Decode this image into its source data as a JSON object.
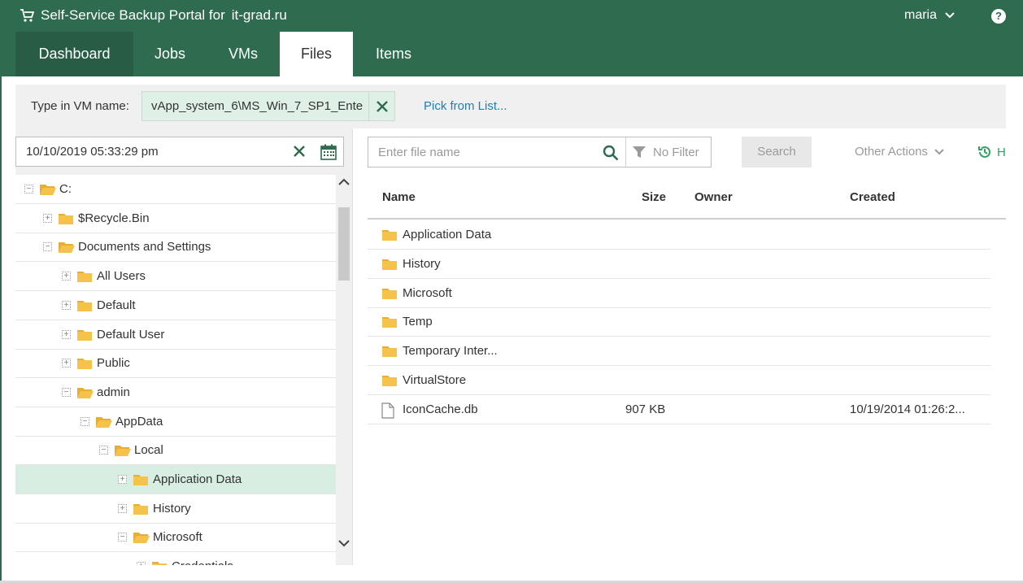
{
  "header": {
    "app_title": "Self-Service Backup Portal for",
    "tenant": "it-grad.ru",
    "user": "maria",
    "help_label": "?"
  },
  "tabs": [
    {
      "label": "Dashboard"
    },
    {
      "label": "Jobs"
    },
    {
      "label": "VMs"
    },
    {
      "label": "Files"
    },
    {
      "label": "Items"
    }
  ],
  "vm_bar": {
    "label": "Type in VM name:",
    "value": "vApp_system_6\\MS_Win_7_SP1_Ente",
    "pick_link": "Pick from List..."
  },
  "date_picker": {
    "value": "10/10/2019 05:33:29 pm"
  },
  "tree": {
    "nodes": [
      {
        "label": "C:",
        "state": "expanded",
        "open": true
      },
      {
        "label": "$Recycle.Bin",
        "state": "collapsed",
        "open": false
      },
      {
        "label": "Documents and Settings",
        "state": "expanded",
        "open": true
      },
      {
        "label": "All Users",
        "state": "collapsed",
        "open": false
      },
      {
        "label": "Default",
        "state": "collapsed",
        "open": false
      },
      {
        "label": "Default User",
        "state": "collapsed",
        "open": false
      },
      {
        "label": "Public",
        "state": "collapsed",
        "open": false
      },
      {
        "label": "admin",
        "state": "expanded",
        "open": true
      },
      {
        "label": "AppData",
        "state": "expanded",
        "open": true
      },
      {
        "label": "Local",
        "state": "expanded",
        "open": true
      },
      {
        "label": "Application Data",
        "state": "collapsed",
        "open": false,
        "selected": true
      },
      {
        "label": "History",
        "state": "collapsed",
        "open": false
      },
      {
        "label": "Microsoft",
        "state": "expanded",
        "open": true
      },
      {
        "label": "Credentials",
        "state": "collapsed",
        "open": false
      }
    ]
  },
  "toolbar": {
    "search_placeholder": "Enter file name",
    "filter_label": "No Filter",
    "search_button": "Search",
    "other_actions": "Other Actions",
    "history_label": "H"
  },
  "grid": {
    "columns": [
      "Name",
      "Size",
      "Owner",
      "Created"
    ],
    "rows": [
      {
        "type": "folder",
        "name": "Application Data",
        "size": "",
        "owner": "",
        "created": ""
      },
      {
        "type": "folder",
        "name": "History",
        "size": "",
        "owner": "",
        "created": ""
      },
      {
        "type": "folder",
        "name": "Microsoft",
        "size": "",
        "owner": "",
        "created": ""
      },
      {
        "type": "folder",
        "name": "Temp",
        "size": "",
        "owner": "",
        "created": ""
      },
      {
        "type": "folder",
        "name": "Temporary Inter...",
        "size": "",
        "owner": "",
        "created": ""
      },
      {
        "type": "folder",
        "name": "VirtualStore",
        "size": "",
        "owner": "",
        "created": ""
      },
      {
        "type": "file",
        "name": "IconCache.db",
        "size": "907 KB",
        "owner": "",
        "created": "10/19/2014 01:26:2..."
      }
    ]
  },
  "colors": {
    "brand_green": "#2e6b4f",
    "selected_row": "#d8eee2",
    "link_blue": "#1e7fb4",
    "folder_yellow": "#f5c24c"
  }
}
